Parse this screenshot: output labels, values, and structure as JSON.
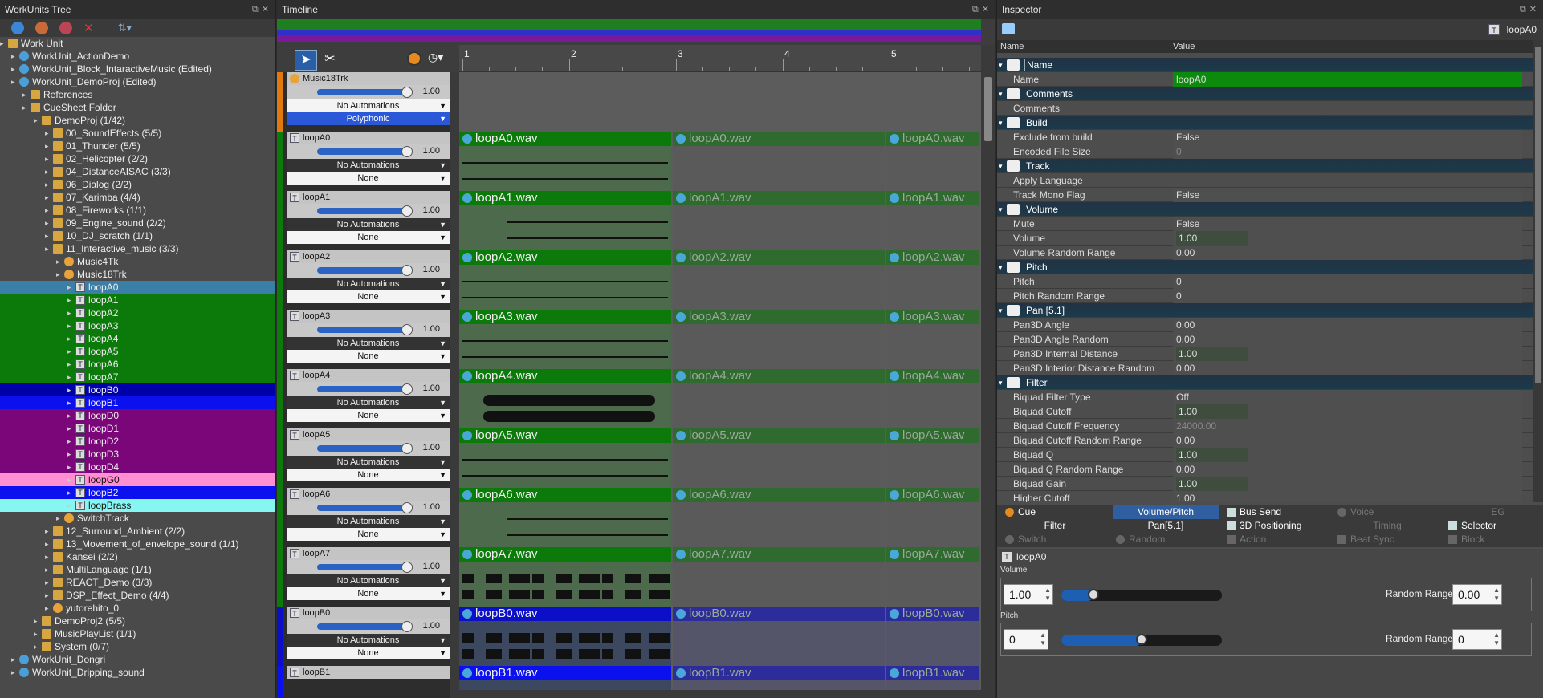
{
  "tree": {
    "title": "WorkUnits Tree",
    "rows": [
      {
        "label": "Work Unit",
        "indent": 0,
        "icon": "folder"
      },
      {
        "label": "WorkUnit_ActionDemo",
        "indent": 1,
        "icon": "globe"
      },
      {
        "label": "WorkUnit_Block_IntaractiveMusic (Edited)",
        "indent": 1,
        "icon": "globe"
      },
      {
        "label": "WorkUnit_DemoProj (Edited)",
        "indent": 1,
        "icon": "globe"
      },
      {
        "label": "References",
        "indent": 2,
        "icon": "folder"
      },
      {
        "label": "CueSheet Folder",
        "indent": 2,
        "icon": "folder"
      },
      {
        "label": "DemoProj (1/42)",
        "indent": 3,
        "icon": "folder"
      },
      {
        "label": "00_SoundEffects (5/5)",
        "indent": 4,
        "icon": "folder"
      },
      {
        "label": "01_Thunder (5/5)",
        "indent": 4,
        "icon": "folder"
      },
      {
        "label": "02_Helicopter (2/2)",
        "indent": 4,
        "icon": "folder"
      },
      {
        "label": "04_DistanceAISAC (3/3)",
        "indent": 4,
        "icon": "folder"
      },
      {
        "label": "06_Dialog (2/2)",
        "indent": 4,
        "icon": "folder"
      },
      {
        "label": "07_Karimba (4/4)",
        "indent": 4,
        "icon": "folder"
      },
      {
        "label": "08_Fireworks (1/1)",
        "indent": 4,
        "icon": "folder"
      },
      {
        "label": "09_Engine_sound (2/2)",
        "indent": 4,
        "icon": "folder"
      },
      {
        "label": "10_DJ_scratch (1/1)",
        "indent": 4,
        "icon": "folder"
      },
      {
        "label": "11_Interactive_music (3/3)",
        "indent": 4,
        "icon": "folder"
      },
      {
        "label": "Music4Tk",
        "indent": 5,
        "icon": "cue"
      },
      {
        "label": "Music18Trk",
        "indent": 5,
        "icon": "cue"
      },
      {
        "label": "loopA0",
        "indent": 6,
        "icon": "track",
        "bg": "#3a7fa6"
      },
      {
        "label": "loopA1",
        "indent": 6,
        "icon": "track",
        "bg": "#0b7a0b"
      },
      {
        "label": "loopA2",
        "indent": 6,
        "icon": "track",
        "bg": "#0b7a0b"
      },
      {
        "label": "loopA3",
        "indent": 6,
        "icon": "track",
        "bg": "#0b7a0b"
      },
      {
        "label": "loopA4",
        "indent": 6,
        "icon": "track",
        "bg": "#0b7a0b"
      },
      {
        "label": "loopA5",
        "indent": 6,
        "icon": "track",
        "bg": "#0b7a0b"
      },
      {
        "label": "loopA6",
        "indent": 6,
        "icon": "track",
        "bg": "#0b7a0b"
      },
      {
        "label": "loopA7",
        "indent": 6,
        "icon": "track",
        "bg": "#0b7a0b"
      },
      {
        "label": "loopB0",
        "indent": 6,
        "icon": "track",
        "bg": "#0000a8"
      },
      {
        "label": "loopB1",
        "indent": 6,
        "icon": "track",
        "bg": "#0b10ee"
      },
      {
        "label": "loopD0",
        "indent": 6,
        "icon": "track",
        "bg": "#7a067a"
      },
      {
        "label": "loopD1",
        "indent": 6,
        "icon": "track",
        "bg": "#7a067a"
      },
      {
        "label": "loopD2",
        "indent": 6,
        "icon": "track",
        "bg": "#7a067a"
      },
      {
        "label": "loopD3",
        "indent": 6,
        "icon": "track",
        "bg": "#7a067a"
      },
      {
        "label": "loopD4",
        "indent": 6,
        "icon": "track",
        "bg": "#7a067a"
      },
      {
        "label": "loopG0",
        "indent": 6,
        "icon": "track",
        "bg": "#ff8fd0",
        "dark": true
      },
      {
        "label": "loopB2",
        "indent": 6,
        "icon": "track",
        "bg": "#0b10ee"
      },
      {
        "label": "loopBrass",
        "indent": 6,
        "icon": "track",
        "bg": "#86f6f2",
        "dark": true
      },
      {
        "label": "SwitchTrack",
        "indent": 5,
        "icon": "cue"
      },
      {
        "label": "12_Surround_Ambient (2/2)",
        "indent": 4,
        "icon": "folder"
      },
      {
        "label": "13_Movement_of_envelope_sound (1/1)",
        "indent": 4,
        "icon": "folder"
      },
      {
        "label": "Kansei (2/2)",
        "indent": 4,
        "icon": "folder"
      },
      {
        "label": "MultiLanguage (1/1)",
        "indent": 4,
        "icon": "folder"
      },
      {
        "label": "REACT_Demo (3/3)",
        "indent": 4,
        "icon": "folder"
      },
      {
        "label": "DSP_Effect_Demo (4/4)",
        "indent": 4,
        "icon": "folder"
      },
      {
        "label": "yutorehito_0",
        "indent": 4,
        "icon": "cue"
      },
      {
        "label": "DemoProj2 (5/5)",
        "indent": 3,
        "icon": "folder"
      },
      {
        "label": "MusicPlayList (1/1)",
        "indent": 3,
        "icon": "folder"
      },
      {
        "label": "System (0/7)",
        "indent": 3,
        "icon": "folder"
      },
      {
        "label": "WorkUnit_Dongri",
        "indent": 1,
        "icon": "globe"
      },
      {
        "label": "WorkUnit_Dripping_sound",
        "indent": 1,
        "icon": "globe"
      }
    ]
  },
  "timeline": {
    "title": "Timeline",
    "ruler": [
      "1",
      "2",
      "3",
      "4",
      "5"
    ],
    "cue": {
      "name": "Music18Trk",
      "volume": "1.00",
      "automation": "No Automations",
      "mode": "Polyphonic"
    },
    "tracks": [
      {
        "name": "loopA0",
        "volume": "1.00",
        "automation": "No Automations",
        "select": "None",
        "color": "#0b7a0b",
        "clip": "loopA0.wav",
        "wave": "dense"
      },
      {
        "name": "loopA1",
        "volume": "1.00",
        "automation": "No Automations",
        "select": "None",
        "color": "#0b7a0b",
        "clip": "loopA1.wav",
        "wave": "sparse"
      },
      {
        "name": "loopA2",
        "volume": "1.00",
        "automation": "No Automations",
        "select": "None",
        "color": "#0b7a0b",
        "clip": "loopA2.wav",
        "wave": "dense"
      },
      {
        "name": "loopA3",
        "volume": "1.00",
        "automation": "No Automations",
        "select": "None",
        "color": "#0b7a0b",
        "clip": "loopA3.wav",
        "wave": "dense"
      },
      {
        "name": "loopA4",
        "volume": "1.00",
        "automation": "No Automations",
        "select": "None",
        "color": "#0b7a0b",
        "clip": "loopA4.wav",
        "wave": "blob"
      },
      {
        "name": "loopA5",
        "volume": "1.00",
        "automation": "No Automations",
        "select": "None",
        "color": "#0b7a0b",
        "clip": "loopA5.wav",
        "wave": "dense"
      },
      {
        "name": "loopA6",
        "volume": "1.00",
        "automation": "No Automations",
        "select": "None",
        "color": "#0b7a0b",
        "clip": "loopA6.wav",
        "wave": "sparse"
      },
      {
        "name": "loopA7",
        "volume": "1.00",
        "automation": "No Automations",
        "select": "None",
        "color": "#0b7a0b",
        "clip": "loopA7.wav",
        "wave": "chunks"
      },
      {
        "name": "loopB0",
        "volume": "1.00",
        "automation": "No Automations",
        "select": "None",
        "color": "#0b10c8",
        "clip": "loopB0.wav",
        "wave": "chunks"
      },
      {
        "name": "loopB1",
        "volume": "",
        "automation": "",
        "select": "",
        "color": "#0b10ee",
        "clip": "loopB1.wav",
        "wave": "none"
      }
    ]
  },
  "inspector": {
    "title": "Inspector",
    "selected": "loopA0",
    "col_name": "Name",
    "col_value": "Value",
    "rows": [
      {
        "type": "sec",
        "label": "Name",
        "edit": true
      },
      {
        "type": "row",
        "key": "Name",
        "value": "loopA0",
        "green": true
      },
      {
        "type": "sec",
        "label": "Comments"
      },
      {
        "type": "row",
        "key": "Comments",
        "value": ""
      },
      {
        "type": "sec",
        "label": "Build"
      },
      {
        "type": "row",
        "key": "Exclude from build",
        "value": "False"
      },
      {
        "type": "row",
        "key": "Encoded File Size",
        "value": "0",
        "dim": true
      },
      {
        "type": "sec",
        "label": "Track"
      },
      {
        "type": "row",
        "key": "Apply Language",
        "value": ""
      },
      {
        "type": "row",
        "key": "Track Mono Flag",
        "value": "False"
      },
      {
        "type": "sec",
        "label": "Volume"
      },
      {
        "type": "row",
        "key": "Mute",
        "value": "False"
      },
      {
        "type": "row",
        "key": "Volume",
        "value": "1.00",
        "bar": true
      },
      {
        "type": "row",
        "key": "Volume Random Range",
        "value": "0.00"
      },
      {
        "type": "sec",
        "label": "Pitch"
      },
      {
        "type": "row",
        "key": "Pitch",
        "value": "0"
      },
      {
        "type": "row",
        "key": "Pitch Random Range",
        "value": "0"
      },
      {
        "type": "sec",
        "label": "Pan [5.1]"
      },
      {
        "type": "row",
        "key": "Pan3D Angle",
        "value": "0.00"
      },
      {
        "type": "row",
        "key": "Pan3D Angle Random",
        "value": "0.00"
      },
      {
        "type": "row",
        "key": "Pan3D Internal Distance",
        "value": "1.00",
        "bar": true
      },
      {
        "type": "row",
        "key": "Pan3D Interior Distance Random",
        "value": "0.00"
      },
      {
        "type": "sec",
        "label": "Filter"
      },
      {
        "type": "row",
        "key": "Biquad Filter Type",
        "value": "Off"
      },
      {
        "type": "row",
        "key": "Biquad Cutoff",
        "value": "1.00",
        "bar": true
      },
      {
        "type": "row",
        "key": "Biquad Cutoff Frequency",
        "value": "24000.00",
        "dim": true
      },
      {
        "type": "row",
        "key": "Biquad Cutoff Random Range",
        "value": "0.00"
      },
      {
        "type": "row",
        "key": "Biquad Q",
        "value": "1.00",
        "bar": true
      },
      {
        "type": "row",
        "key": "Biquad Q Random Range",
        "value": "0.00"
      },
      {
        "type": "row",
        "key": "Biquad Gain",
        "value": "1.00",
        "bar": true
      },
      {
        "type": "row",
        "key": "Higher Cutoff",
        "value": "1.00"
      }
    ],
    "tabs": [
      {
        "label": "Cue",
        "col": 0,
        "row": 0,
        "ico": "cue"
      },
      {
        "label": "Volume/Pitch",
        "col": 1,
        "row": 0,
        "active": true
      },
      {
        "label": "Bus Send",
        "col": 2,
        "row": 0,
        "ico": "sq"
      },
      {
        "label": "Voice",
        "col": 3,
        "row": 0,
        "dis": true,
        "ico": "cue"
      },
      {
        "label": "EG",
        "col": 4,
        "row": 0,
        "dis": true
      },
      {
        "label": "Filter",
        "col": 0,
        "row": 1
      },
      {
        "label": "Pan[5.1]",
        "col": 1,
        "row": 1
      },
      {
        "label": "3D Positioning",
        "col": 2,
        "row": 1,
        "ico": "sq"
      },
      {
        "label": "Timing",
        "col": 3,
        "row": 1,
        "dis": true
      },
      {
        "label": "Selector",
        "col": 4,
        "row": 1,
        "ico": "sq"
      },
      {
        "label": "Switch",
        "col": 0,
        "row": 2,
        "dis": true,
        "ico": "cue"
      },
      {
        "label": "Random",
        "col": 1,
        "row": 2,
        "dis": true,
        "ico": "cue"
      },
      {
        "label": "Action",
        "col": 2,
        "row": 2,
        "dis": true,
        "ico": "sq"
      },
      {
        "label": "Beat Sync",
        "col": 3,
        "row": 2,
        "dis": true,
        "ico": "sq"
      },
      {
        "label": "Block",
        "col": 4,
        "row": 2,
        "dis": true,
        "ico": "sq"
      }
    ],
    "editor": {
      "item": "loopA0",
      "volume_label": "Volume",
      "volume_value": "1.00",
      "volume_level": 0.2,
      "random_label": "Random Range",
      "volume_random": "0.00",
      "pitch_label": "Pitch",
      "pitch_value": "0",
      "pitch_level": 0.5,
      "pitch_random": "0"
    }
  }
}
